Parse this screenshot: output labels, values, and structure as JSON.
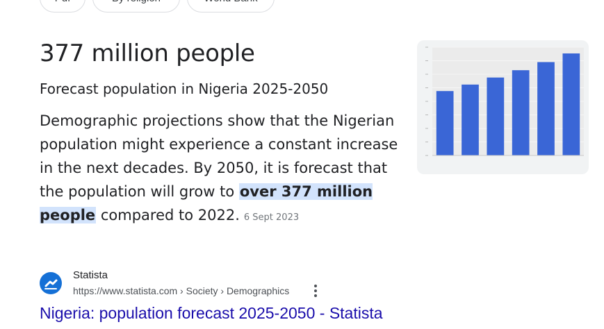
{
  "chips": [
    {
      "label": "Pdf"
    },
    {
      "label": "By religion"
    },
    {
      "label": "World Bank"
    }
  ],
  "answer": {
    "headline": "377 million people",
    "subtitle": "Forecast population in Nigeria 2025-2050",
    "snippet_before": "Demographic projections show that the Nigerian population might experience a constant increase in the next decades. By 2050, it is forecast that the population will grow to ",
    "snippet_highlight": "over 377 million people",
    "snippet_after": " compared to 2022.",
    "date": "6 Sept 2023"
  },
  "thumbnail": {
    "bar_color": "#3a66d6",
    "bars": [
      {
        "value": 238
      },
      {
        "value": 262
      },
      {
        "value": 288
      },
      {
        "value": 315
      },
      {
        "value": 345
      },
      {
        "value": 377
      }
    ]
  },
  "source": {
    "name": "Statista",
    "url": "https://www.statista.com › Society › Demographics",
    "title": "Nigeria: population forecast 2025-2050 - Statista"
  }
}
